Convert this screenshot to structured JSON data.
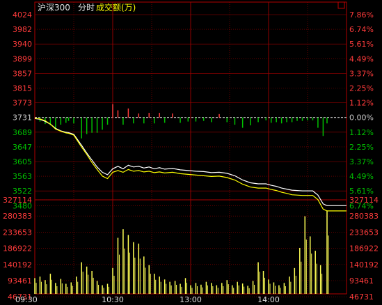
{
  "header": {
    "index_name": "沪深300",
    "mode_label": "分时",
    "volume_label": "成交额(万)",
    "close_glyph": "☐"
  },
  "colors": {
    "background": "#000000",
    "frame": "#b00000",
    "grid": "#a00000",
    "up": "#ff3b3b",
    "down": "#00c000",
    "flat": "#c8c8c8",
    "price_line": "#ffffff",
    "avg_line": "#ffff00",
    "volume_bar": "#ffff55",
    "header_white": "#e0e0e0",
    "header_yellow": "#ffff00"
  },
  "chart_data": [
    {
      "type": "line",
      "title": "",
      "prev_close": 3731,
      "y_ticks_left": [
        "4024",
        "3982",
        "3940",
        "3899",
        "3857",
        "3815",
        "3773",
        "3731",
        "3689",
        "3647",
        "3605",
        "3563",
        "3522",
        "3480"
      ],
      "y_ticks_right": [
        "7.86%",
        "6.74%",
        "5.61%",
        "4.49%",
        "3.37%",
        "2.25%",
        "1.12%",
        "0.00%",
        "1.12%",
        "2.25%",
        "3.37%",
        "4.49%",
        "5.61%",
        "6.74%"
      ],
      "ylim": [
        3480,
        4024
      ],
      "x_ticks": [
        "09:30",
        "10:30",
        "13:00",
        "14:00"
      ],
      "series": [
        {
          "x": [
            0,
            4,
            8,
            12,
            16,
            20,
            24,
            26,
            30,
            36,
            40,
            44,
            48,
            52,
            56,
            60,
            64,
            68,
            72,
            76,
            80,
            84,
            88,
            92,
            96,
            100,
            106,
            112,
            118,
            124,
            130,
            136,
            142,
            148,
            154,
            160,
            166,
            172,
            178,
            182,
            186,
            190,
            194,
            198,
            202,
            206,
            210,
            214,
            218,
            222,
            225
          ],
          "values": [
            3728,
            3726,
            3720,
            3712,
            3700,
            3693,
            3689,
            3688,
            3683,
            3652,
            3630,
            3610,
            3590,
            3575,
            3568,
            3585,
            3592,
            3585,
            3595,
            3590,
            3592,
            3587,
            3590,
            3585,
            3588,
            3584,
            3586,
            3582,
            3580,
            3578,
            3577,
            3574,
            3575,
            3572,
            3565,
            3553,
            3545,
            3542,
            3542,
            3538,
            3535,
            3530,
            3527,
            3524,
            3523,
            3522,
            3522,
            3522,
            3510,
            3485,
            3480
          ]
        },
        {
          "x": [
            0,
            4,
            8,
            12,
            16,
            20,
            24,
            26,
            30,
            36,
            40,
            44,
            48,
            52,
            56,
            60,
            64,
            68,
            72,
            76,
            80,
            84,
            88,
            92,
            96,
            100,
            106,
            112,
            118,
            124,
            130,
            136,
            142,
            148,
            154,
            160,
            166,
            172,
            178,
            182,
            186,
            190,
            194,
            198,
            202,
            206,
            210,
            214,
            218,
            222,
            225
          ],
          "values": [
            3729,
            3727,
            3722,
            3712,
            3698,
            3692,
            3687,
            3686,
            3681,
            3647,
            3626,
            3603,
            3583,
            3564,
            3557,
            3575,
            3580,
            3575,
            3583,
            3578,
            3580,
            3576,
            3578,
            3574,
            3576,
            3573,
            3575,
            3571,
            3569,
            3567,
            3565,
            3563,
            3564,
            3560,
            3553,
            3541,
            3533,
            3530,
            3530,
            3526,
            3523,
            3518,
            3515,
            3511,
            3510,
            3509,
            3509,
            3509,
            3497,
            3470,
            3465
          ]
        }
      ]
    },
    {
      "type": "bar",
      "title": "",
      "ylim": [
        0,
        327114
      ],
      "y_ticks_left": [
        "327114",
        "280383",
        "233653",
        "186922",
        "140192",
        "93461",
        "46731"
      ],
      "y_ticks_right": [
        "327114",
        "280383",
        "233653",
        "186922",
        "140192",
        "93461",
        "46731"
      ],
      "x_ticks": [
        "09:30",
        "10:30",
        "13:00",
        "14:00"
      ],
      "x": [
        0,
        4,
        8,
        12,
        16,
        20,
        24,
        28,
        32,
        36,
        40,
        44,
        48,
        52,
        56,
        60,
        64,
        68,
        72,
        76,
        80,
        84,
        88,
        92,
        96,
        100,
        104,
        108,
        112,
        116,
        120,
        124,
        128,
        132,
        136,
        140,
        144,
        148,
        152,
        156,
        160,
        164,
        168,
        172,
        176,
        180,
        184,
        188,
        192,
        196,
        200,
        204,
        208,
        212,
        216,
        220,
        225
      ],
      "values": [
        55000,
        60000,
        48000,
        70000,
        38000,
        52000,
        35000,
        40000,
        60000,
        110000,
        95000,
        80000,
        45000,
        30000,
        35000,
        90000,
        195000,
        225000,
        205000,
        180000,
        175000,
        130000,
        100000,
        70000,
        60000,
        50000,
        42000,
        45000,
        35000,
        55000,
        30000,
        38000,
        32000,
        42000,
        38000,
        30000,
        38000,
        48000,
        30000,
        42000,
        36000,
        28000,
        45000,
        110000,
        80000,
        50000,
        40000,
        30000,
        38000,
        60000,
        90000,
        160000,
        270000,
        200000,
        150000,
        100000,
        290000
      ]
    }
  ]
}
